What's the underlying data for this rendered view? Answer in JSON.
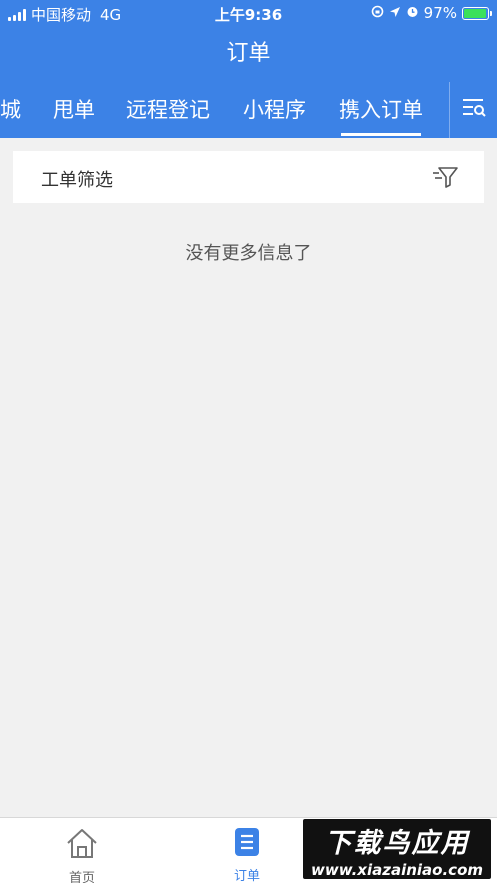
{
  "status_bar": {
    "carrier": "中国移动",
    "network": "4G",
    "time": "上午9:36",
    "battery": "97%",
    "battery_level": 0.97
  },
  "header": {
    "title": "订单"
  },
  "tabs": [
    {
      "label": "商城",
      "active": false
    },
    {
      "label": "甩单",
      "active": false
    },
    {
      "label": "远程登记",
      "active": false
    },
    {
      "label": "小程序",
      "active": false
    },
    {
      "label": "携入订单",
      "active": true
    }
  ],
  "filter": {
    "label": "工单筛选"
  },
  "empty_message": "没有更多信息了",
  "bottom_nav": [
    {
      "label": "首页",
      "icon": "home-icon"
    },
    {
      "label": "订单",
      "icon": "order-list-icon"
    }
  ],
  "watermark": {
    "line1": "下载鸟应用",
    "line2": "www.xiazainiao.com"
  },
  "colors": {
    "primary": "#3c82e6",
    "background": "#f1f1f1"
  }
}
